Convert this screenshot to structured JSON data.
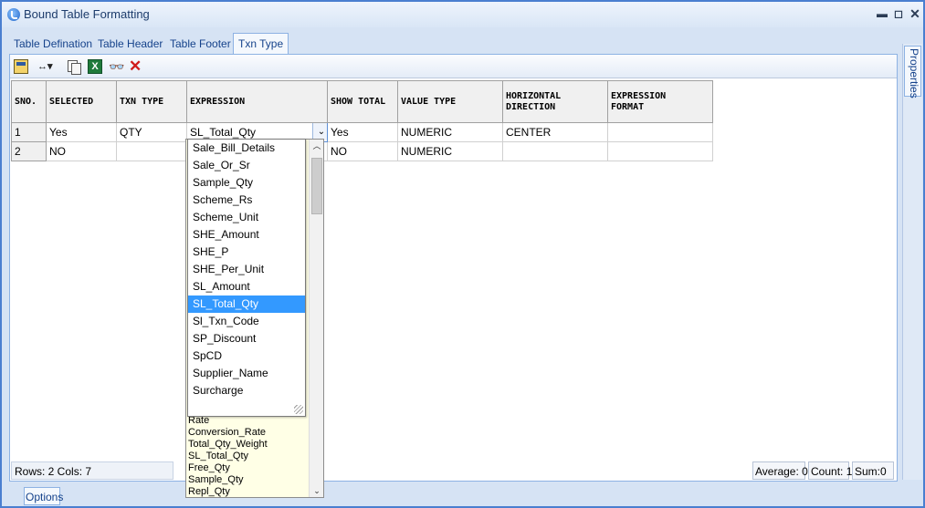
{
  "window": {
    "title": "Bound Table Formatting",
    "controls": {
      "pin": "▬",
      "maximize": "◻",
      "close": "✕"
    }
  },
  "tabs": [
    {
      "label": "Table Defination",
      "active": false
    },
    {
      "label": "Table Header",
      "active": false
    },
    {
      "label": "Table Footer",
      "active": false
    },
    {
      "label": "Txn Type",
      "active": true
    }
  ],
  "toolbar": {
    "resize_glyph": "↔▾",
    "excel_glyph": "X",
    "find_glyph": "👓",
    "delete_glyph": "✕"
  },
  "grid": {
    "columns": [
      "SNO.",
      "SELECTED",
      "TXN TYPE",
      "EXPRESSION",
      "SHOW TOTAL",
      "VALUE TYPE",
      "HORIZONTAL\nDIRECTION",
      "EXPRESSION\nFORMAT"
    ],
    "rows": [
      {
        "sno": "1",
        "selected": "Yes",
        "txn_type": "QTY",
        "expression": "SL_Total_Qty",
        "show_total": "Yes",
        "value_type": "NUMERIC",
        "horizontal": "CENTER",
        "format": ""
      },
      {
        "sno": "2",
        "selected": "NO",
        "txn_type": "",
        "expression": "",
        "show_total": "NO",
        "value_type": "NUMERIC",
        "horizontal": "",
        "format": ""
      }
    ],
    "combo_arrow": "⌄"
  },
  "dropdown": {
    "options": [
      "Sale_Bill_Details",
      "Sale_Or_Sr",
      "Sample_Qty",
      "Scheme_Rs",
      "Scheme_Unit",
      "SHE_Amount",
      "SHE_P",
      "SHE_Per_Unit",
      "SL_Amount",
      "SL_Total_Qty",
      "Sl_Txn_Code",
      "SP_Discount",
      "SpCD",
      "Supplier_Name",
      "Surcharge"
    ],
    "selected": "SL_Total_Qty"
  },
  "back_list": {
    "items": [
      "Rate",
      "Conversion_Rate",
      "Total_Qty_Weight",
      "SL_Total_Qty",
      "Free_Qty",
      "Sample_Qty",
      "Repl_Qty"
    ],
    "up_arrow": "︿",
    "down_arrow": "⌄"
  },
  "status": {
    "rows_cols": "Rows: 2   Cols: 7",
    "average": "Average: 0",
    "count": "Count: 1",
    "sum": "Sum:0"
  },
  "side_panel": {
    "label": "Properties"
  },
  "bottom_tab": {
    "label": "Options"
  },
  "colors": {
    "accent": "#4a7fd0",
    "selection": "#3399ff",
    "tab_text": "#15428b"
  }
}
